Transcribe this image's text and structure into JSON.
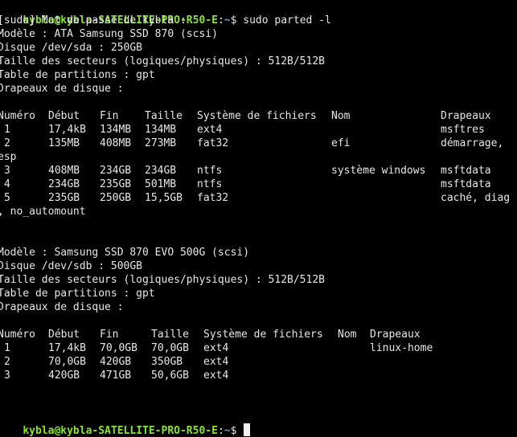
{
  "prompt": {
    "user_host": "kybla@kybla-SATELLITE-PRO-R50-E",
    "sep": ":",
    "path": "~",
    "symbol": "$ ",
    "command": "sudo parted -l"
  },
  "sudo_prompt": "[sudo] Mot de passe de kybla :",
  "disk1": {
    "model": "Modèle : ATA Samsung SSD 870 (scsi)",
    "disk": "Disque /dev/sda : 250GB",
    "sector_size": "Taille des secteurs (logiques/physiques) : 512B/512B",
    "partition_table": "Table de partitions : gpt",
    "disk_flags": "Drapeaux de disque :",
    "headers": [
      "Numéro",
      "Début",
      "Fin",
      "Taille",
      "Système de fichiers",
      "Nom",
      "Drapeaux"
    ],
    "rows": [
      [
        "1",
        "17,4kB",
        "134MB",
        "134MB",
        "ext4",
        "",
        "msftres"
      ],
      [
        "2",
        "135MB",
        "408MB",
        "273MB",
        "fat32",
        "efi",
        "démarrage,"
      ],
      [
        "3",
        "408MB",
        "234GB",
        "234GB",
        "ntfs",
        "système windows",
        "msftdata"
      ],
      [
        "4",
        "234GB",
        "235GB",
        "501MB",
        "ntfs",
        "",
        "msftdata"
      ],
      [
        "5",
        "235GB",
        "250GB",
        "15,5GB",
        "fat32",
        "",
        "caché, diag"
      ]
    ],
    "wrap_row2": "esp",
    "wrap_row5": ", no_automount"
  },
  "disk2": {
    "model": "Modèle : Samsung SSD 870 EVO 500G (scsi)",
    "disk": "Disque /dev/sdb : 500GB",
    "sector_size": "Taille des secteurs (logiques/physiques) : 512B/512B",
    "partition_table": "Table de partitions : gpt",
    "disk_flags": "Drapeaux de disque :",
    "headers": [
      "Numéro",
      "Début",
      "Fin",
      "Taille",
      "Système de fichiers",
      "Nom",
      "Drapeaux"
    ],
    "rows": [
      [
        "1",
        "17,4kB",
        "70,0GB",
        "70,0GB",
        "ext4",
        "",
        "linux-home"
      ],
      [
        "2",
        "70,0GB",
        "420GB",
        "350GB",
        "ext4",
        "",
        ""
      ],
      [
        "3",
        "420GB",
        "471GB",
        "50,6GB",
        "ext4",
        "",
        ""
      ]
    ]
  },
  "colors": {
    "background": "#000000",
    "text": "#e6e6e6",
    "prompt_user": "#8ae234",
    "prompt_path": "#729fcf"
  }
}
